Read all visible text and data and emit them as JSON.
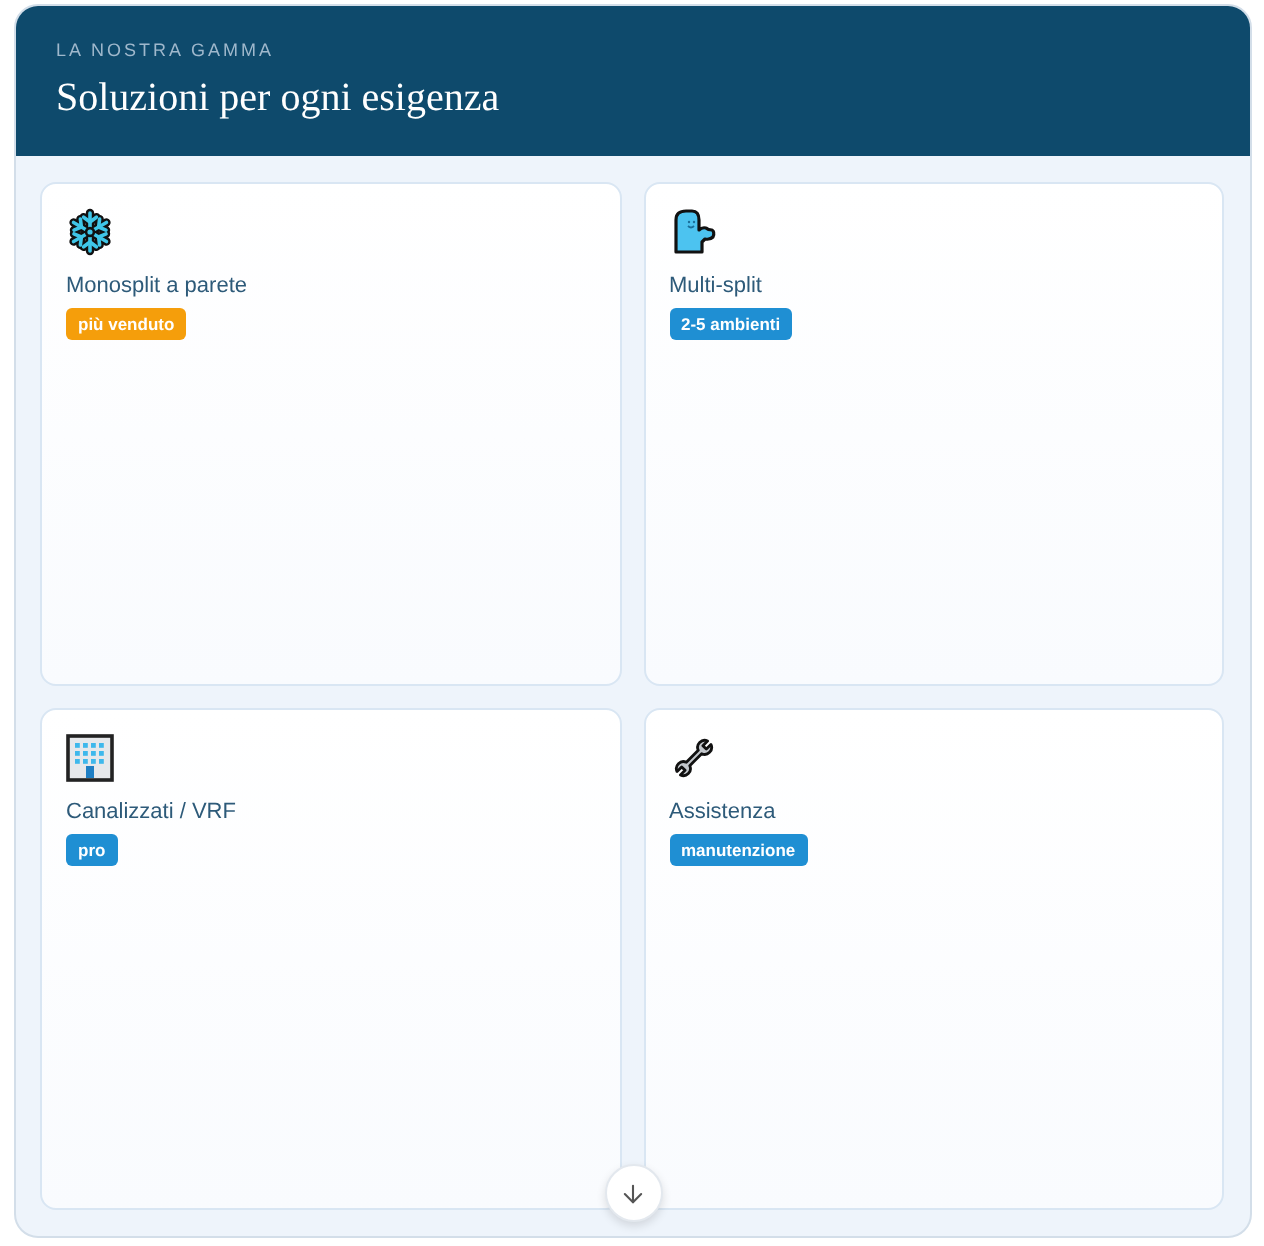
{
  "header": {
    "eyebrow": "LA NOSTRA GAMMA",
    "title": "Soluzioni per ogni esigenza"
  },
  "cards": [
    {
      "title": "Monosplit a parete",
      "badge": {
        "text": "più venduto",
        "color": "#f59e0b"
      }
    },
    {
      "title": "Multi-split",
      "badge": {
        "text": "2-5 ambienti",
        "color": "#1f8fd3"
      }
    },
    {
      "title": "Canalizzati / VRF",
      "badge": {
        "text": "pro",
        "color": "#1f8fd3"
      }
    },
    {
      "title": "Assistenza",
      "badge": {
        "text": "manutenzione",
        "color": "#1f8fd3"
      }
    }
  ]
}
